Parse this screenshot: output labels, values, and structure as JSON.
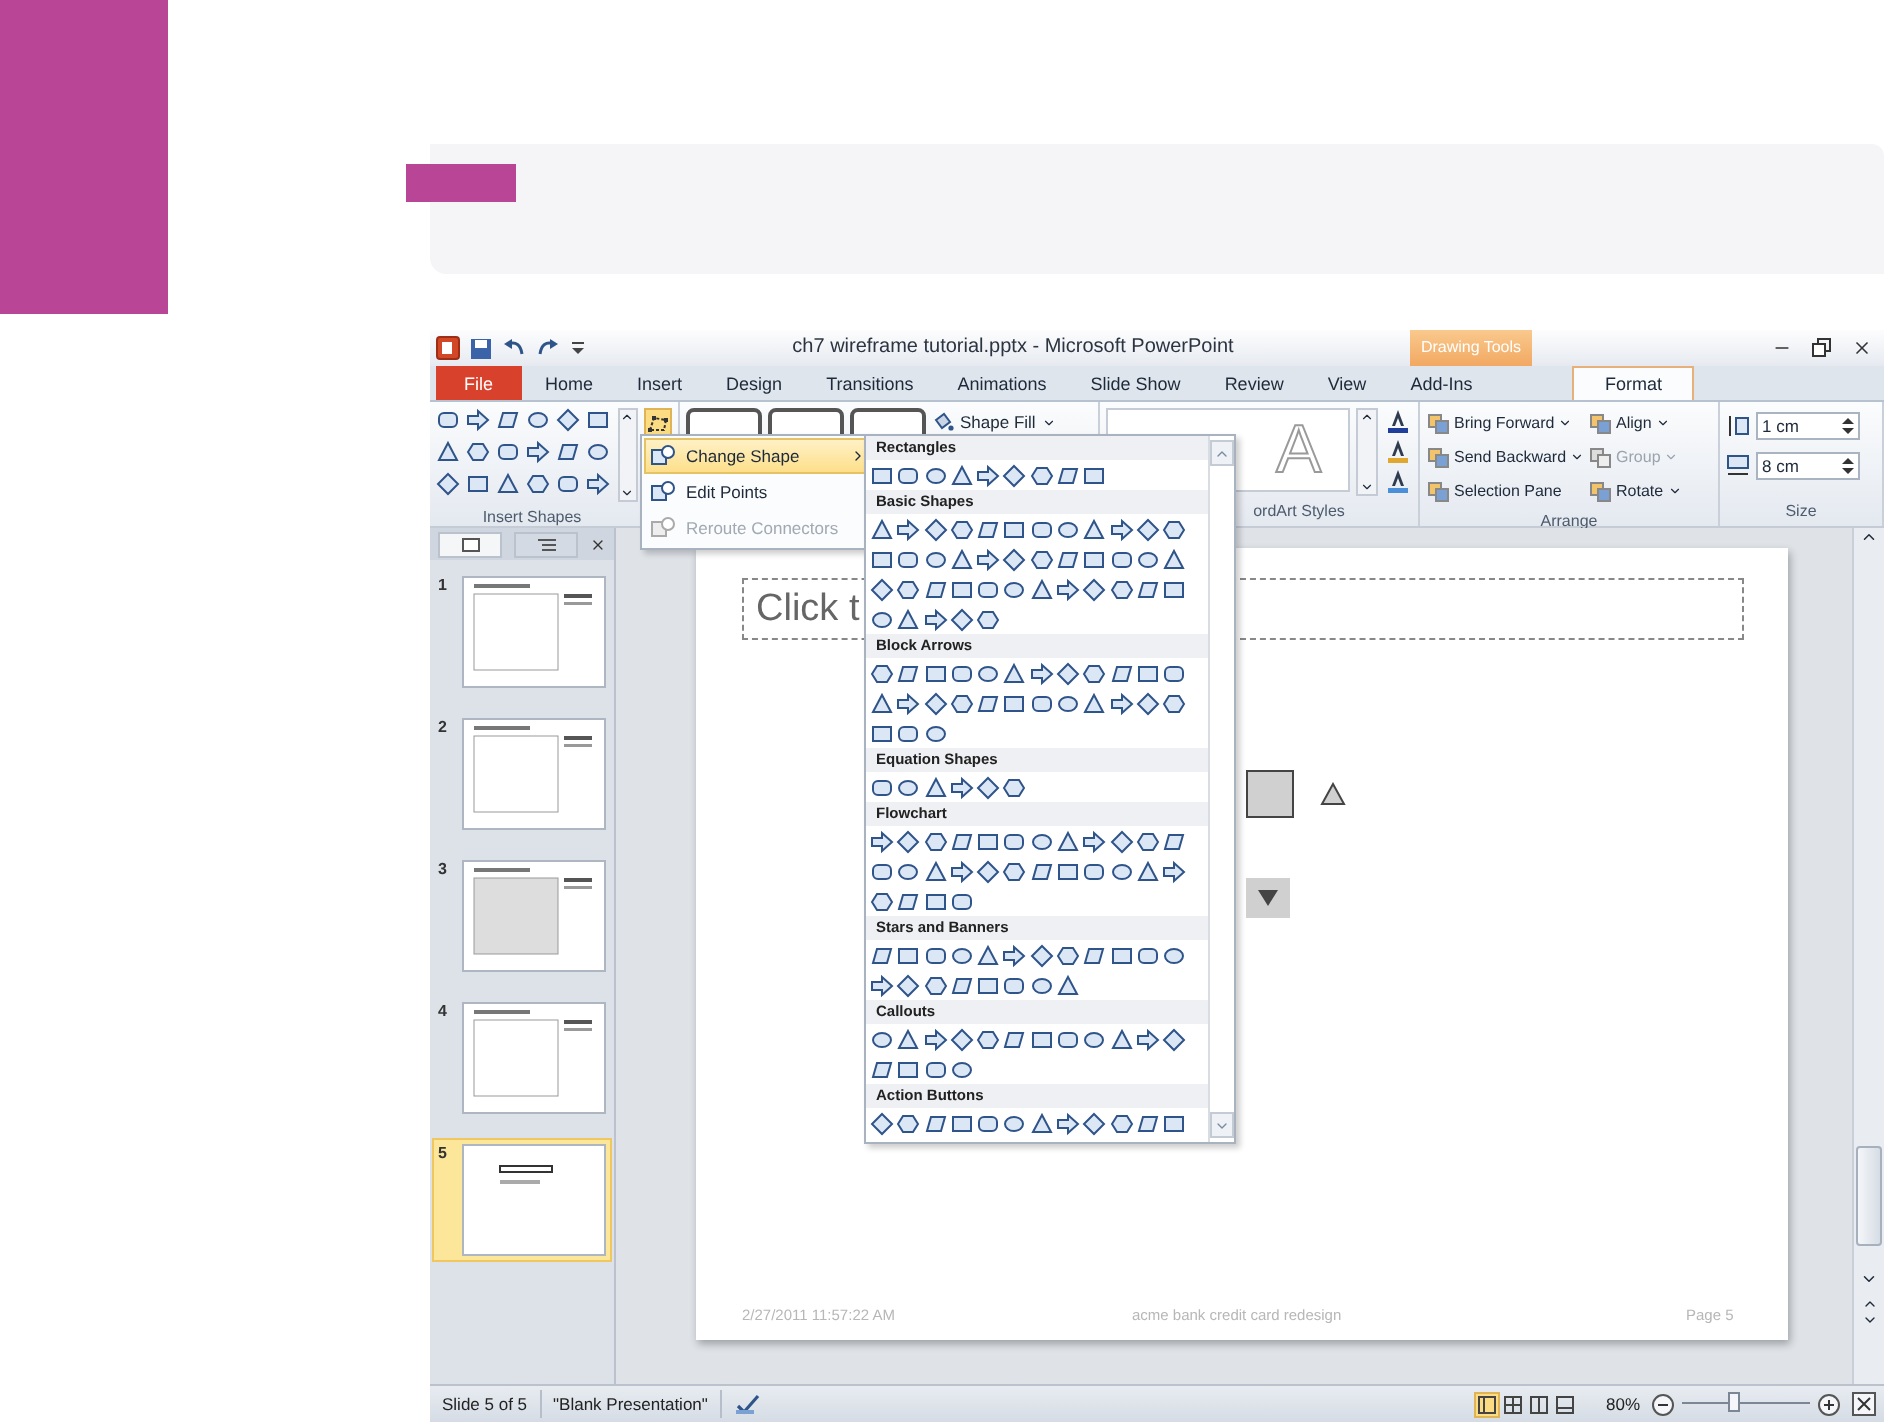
{
  "window": {
    "title": "ch7 wireframe tutorial.pptx - Microsoft PowerPoint",
    "context_group": "Drawing Tools"
  },
  "ribbon_tabs": [
    {
      "label": "File",
      "kind": "file",
      "selected": false
    },
    {
      "label": "Home",
      "kind": "normal",
      "selected": false
    },
    {
      "label": "Insert",
      "kind": "normal",
      "selected": false
    },
    {
      "label": "Design",
      "kind": "normal",
      "selected": false
    },
    {
      "label": "Transitions",
      "kind": "normal",
      "selected": false
    },
    {
      "label": "Animations",
      "kind": "normal",
      "selected": false
    },
    {
      "label": "Slide Show",
      "kind": "normal",
      "selected": false
    },
    {
      "label": "Review",
      "kind": "normal",
      "selected": false
    },
    {
      "label": "View",
      "kind": "normal",
      "selected": false
    },
    {
      "label": "Add-Ins",
      "kind": "normal",
      "selected": false
    },
    {
      "label": "Format",
      "kind": "context",
      "selected": true
    }
  ],
  "ribbon": {
    "insert_shapes": {
      "label": "Insert Shapes"
    },
    "shape_fill": "Shape Fill",
    "wordart": {
      "samples": [
        {
          "text": "A",
          "kind": "outline"
        }
      ],
      "label": "ordArt Styles"
    },
    "arrange": {
      "label": "Arrange",
      "buttons": [
        {
          "label": "Bring Forward",
          "has_menu": true,
          "disabled": false
        },
        {
          "label": "Send Backward",
          "has_menu": true,
          "disabled": false
        },
        {
          "label": "Selection Pane",
          "has_menu": false,
          "disabled": false
        },
        {
          "label": "Align",
          "has_menu": true,
          "disabled": false
        },
        {
          "label": "Group",
          "has_menu": true,
          "disabled": true
        },
        {
          "label": "Rotate",
          "has_menu": true,
          "disabled": false
        }
      ]
    },
    "size": {
      "label": "Size",
      "height": "1 cm",
      "width": "8 cm"
    }
  },
  "edit_shape_menu": {
    "items": [
      {
        "label": "Change Shape",
        "selected": true,
        "disabled": false
      },
      {
        "label": "Edit Points",
        "selected": false,
        "disabled": false
      },
      {
        "label": "Reroute Connectors",
        "selected": false,
        "disabled": true
      }
    ]
  },
  "shape_gallery": {
    "sections": [
      {
        "title": "Rectangles"
      },
      {
        "title": "Basic Shapes"
      },
      {
        "title": "Block Arrows"
      },
      {
        "title": "Equation Shapes"
      },
      {
        "title": "Flowchart"
      },
      {
        "title": "Stars and Banners"
      },
      {
        "title": "Callouts"
      },
      {
        "title": "Action Buttons"
      }
    ]
  },
  "slides_panel": {
    "thumbnails": [
      {
        "number": "1",
        "selected": false
      },
      {
        "number": "2",
        "selected": false
      },
      {
        "number": "3",
        "selected": false
      },
      {
        "number": "4",
        "selected": false
      },
      {
        "number": "5",
        "selected": true
      }
    ]
  },
  "slide": {
    "title_placeholder": "Click t",
    "footer": {
      "date": "2/27/2011 11:57:22 AM",
      "center": "acme bank credit card redesign",
      "page": "Page 5"
    }
  },
  "status_bar": {
    "slide": "Slide 5 of 5",
    "theme": "\"Blank Presentation\"",
    "zoom": "80%",
    "level": 0.4
  }
}
